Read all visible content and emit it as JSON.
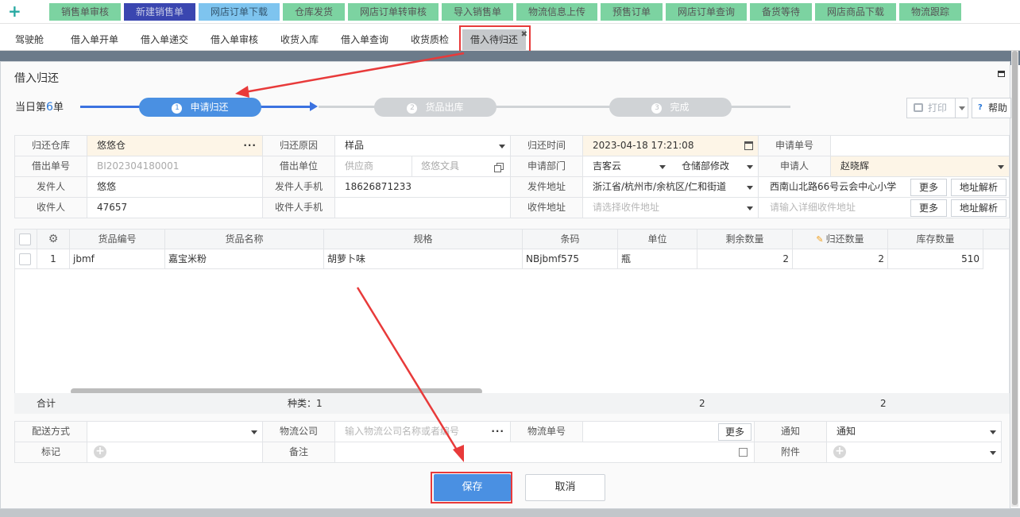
{
  "topbar": {
    "buttons": [
      "销售单审核",
      "新建销售单",
      "网店订单下载",
      "仓库发货",
      "网店订单转审核",
      "导入销售单",
      "物流信息上传",
      "预售订单",
      "网店订单查询",
      "备货等待",
      "网店商品下载",
      "物流跟踪"
    ]
  },
  "tabs": [
    "驾驶舱",
    "借入单开单",
    "借入单递交",
    "借入单审核",
    "收货入库",
    "借入单查询",
    "收货质检",
    "借入待归还"
  ],
  "modal": {
    "title": "借入归还",
    "day_prefix": "当日第",
    "day_num": "6",
    "day_suffix": "单",
    "steps": [
      {
        "num": "1",
        "label": "申请归还"
      },
      {
        "num": "2",
        "label": "货品出库"
      },
      {
        "num": "3",
        "label": "完成"
      }
    ],
    "print_label": "打印",
    "help_label": "帮助"
  },
  "form": {
    "return_wh_label": "归还仓库",
    "return_wh": "悠悠仓",
    "return_reason_label": "归还原因",
    "return_reason": "样品",
    "return_time_label": "归还时间",
    "return_time": "2023-04-18 17:21:08",
    "apply_no_label": "申请单号",
    "apply_no": "",
    "borrow_no_label": "借出单号",
    "borrow_no": "BI202304180001",
    "borrow_unit_label": "借出单位",
    "borrow_unit_a": "供应商",
    "borrow_unit_b": "悠悠文具",
    "apply_dept_label": "申请部门",
    "apply_dept_a": "吉客云",
    "apply_dept_b": "仓储部修改",
    "applicant_label": "申请人",
    "applicant": "赵晓辉",
    "sender_label": "发件人",
    "sender": "悠悠",
    "sender_phone_label": "发件人手机",
    "sender_phone": "18626871233",
    "send_addr_label": "发件地址",
    "send_addr": "浙江省/杭州市/余杭区/仁和街道",
    "send_addr_detail": "西南山北路66号云会中心小学",
    "more": "更多",
    "parse": "地址解析",
    "receiver_label": "收件人",
    "receiver": "47657",
    "receiver_phone_label": "收件人手机",
    "receiver_phone": "",
    "recv_addr_label": "收件地址",
    "recv_addr_ph": "请选择收件地址",
    "recv_addr_detail_ph": "请输入详细收件地址"
  },
  "table": {
    "headers": [
      "",
      "",
      "货品编号",
      "货品名称",
      "规格",
      "条码",
      "单位",
      "剩余数量",
      "归还数量",
      "库存数量"
    ],
    "rows": [
      {
        "idx": "1",
        "code": "jbmf",
        "name": "嘉宝米粉",
        "spec": "胡萝卜味",
        "barcode": "NBjbmf575",
        "unit": "瓶",
        "remain": "2",
        "return": "2",
        "stock": "510"
      }
    ],
    "sum_label": "合计",
    "kinds": "种类：1",
    "sum_remain": "2",
    "sum_return": "2"
  },
  "bottom_form": {
    "ship_label": "配送方式",
    "ship": "",
    "logistics_co_label": "物流公司",
    "logistics_co_ph": "输入物流公司名称或者编号",
    "tracking_label": "物流单号",
    "tracking": "",
    "more": "更多",
    "notify_label": "通知",
    "notify": "通知",
    "tag_label": "标记",
    "remark_label": "备注",
    "remark": "",
    "attach_label": "附件"
  },
  "actions": {
    "save": "保存",
    "cancel": "取消"
  },
  "colors": {
    "accent": "#4a90e2",
    "step_active": "#4a90e2",
    "step_inactive": "#d0d3d6",
    "highlight": "#e83a3a"
  }
}
